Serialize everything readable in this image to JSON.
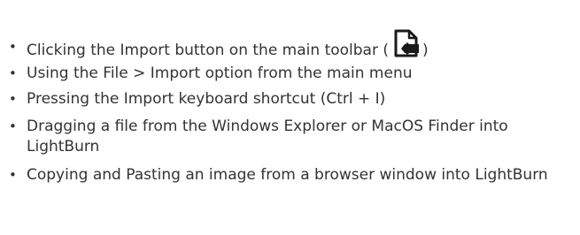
{
  "list": {
    "items": [
      {
        "text_before": "Clicking the Import button on the main toolbar (",
        "icon": "import-file-icon",
        "text_after": ")"
      },
      {
        "text": "Using the File > Import option from the main menu"
      },
      {
        "text": "Pressing the Import keyboard shortcut (Ctrl + I)"
      },
      {
        "text": "Dragging a file from the Windows Explorer or MacOS Finder into LightBurn"
      },
      {
        "text": "Copying and Pasting an image from a browser window into LightBurn"
      }
    ]
  }
}
